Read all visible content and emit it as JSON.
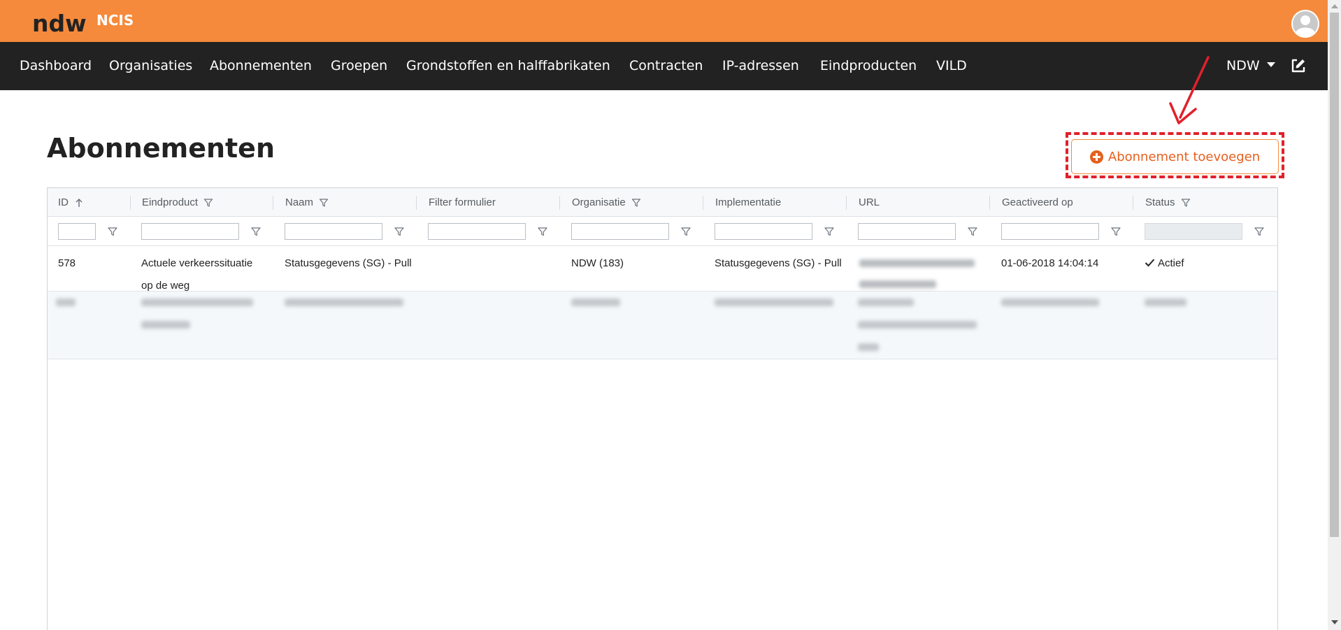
{
  "brand": {
    "logo": "ndw",
    "app_name": "NCIS"
  },
  "nav": {
    "items": [
      "Dashboard",
      "Organisaties",
      "Abonnementen",
      "Groepen",
      "Grondstoffen en halffabrikaten",
      "Contracten",
      "IP-adressen",
      "Eindproducten",
      "VILD"
    ],
    "organisation_selector": "NDW"
  },
  "page": {
    "title": "Abonnementen",
    "add_button_label": "Abonnement toevoegen"
  },
  "table": {
    "columns": [
      "ID",
      "Eindproduct",
      "Naam",
      "Filter formulier",
      "Organisatie",
      "Implementatie",
      "URL",
      "Geactiveerd op",
      "Status"
    ],
    "sort": {
      "column": "ID",
      "direction": "ascending"
    },
    "rows": [
      {
        "id": "578",
        "eindproduct": "Actuele verkeerssituatie op de weg",
        "naam": "Statusgegevens (SG) - Pull",
        "filter_formulier": "",
        "organisatie": "NDW (183)",
        "implementatie": "Statusgegevens (SG) - Pull",
        "url": "",
        "geactiveerd_op": "01-06-2018 14:04:14",
        "status": "Actief"
      }
    ]
  },
  "colors": {
    "top_bar": "#f58a3c",
    "nav_bar": "#222222",
    "accent": "#e65f1e",
    "annotation": "#e0212b"
  },
  "icons": {
    "user": "avatar-icon",
    "edit": "edit-icon",
    "sort": "arrow-up-icon",
    "filter": "filter-icon",
    "add": "plus-circle-icon",
    "status_ok": "check-icon"
  }
}
